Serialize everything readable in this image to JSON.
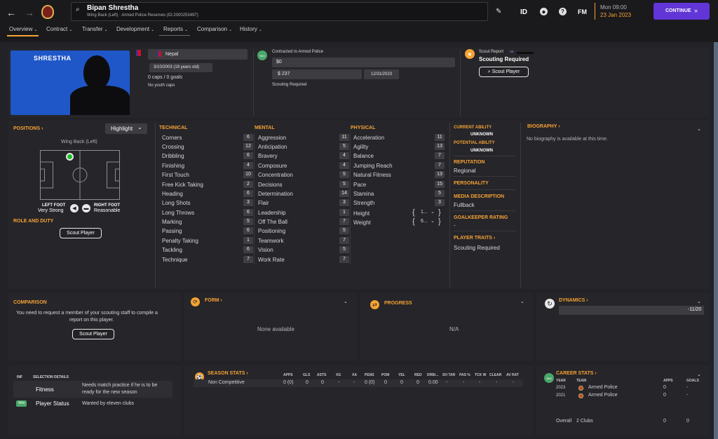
{
  "header": {
    "player_name": "Bipan Shrestha",
    "player_sub": "Wing Back (Left) · Armed Police Reserves (ID:2000253497)",
    "id_label": "ID",
    "fm_label": "FM",
    "time": "Mon 09:00",
    "date": "23 Jan 2023",
    "continue_label": "CONTINUE"
  },
  "nav": {
    "tabs": [
      "Overview",
      "Contract",
      "Transfer",
      "Development",
      "Reports",
      "Comparison",
      "History"
    ]
  },
  "profile": {
    "surname": "SHRESTHA",
    "nation": "Nepal",
    "dob": "3/10/2003 (19 years old)",
    "caps": "0 caps / 0 goals",
    "youth_caps": "No youth caps",
    "contract_title": "Contracted to Armed Police",
    "value": "$0",
    "wage": "$ 237",
    "contract_end": "12/31/2023",
    "contract_note": "Scouting Required",
    "scout_report_label": "Scout Report",
    "scouting_required": "Scouting Required",
    "scout_button": "Scout Player"
  },
  "positions": {
    "title": "POSITIONS",
    "highlight": "Highlight",
    "position": "Wing Back (Left)",
    "left_foot_label": "LEFT FOOT",
    "left_foot_value": "Very Strong",
    "right_foot_label": "RIGHT FOOT",
    "right_foot_value": "Reasonable",
    "role_title": "ROLE AND DUTY",
    "scout_button": "Scout Player"
  },
  "technical": {
    "title": "TECHNICAL",
    "rows": [
      {
        "name": "Corners",
        "value": "6"
      },
      {
        "name": "Crossing",
        "value": "12"
      },
      {
        "name": "Dribbling",
        "value": "6"
      },
      {
        "name": "Finishing",
        "value": "4"
      },
      {
        "name": "First Touch",
        "value": "10"
      },
      {
        "name": "Free Kick Taking",
        "value": "2"
      },
      {
        "name": "Heading",
        "value": "6"
      },
      {
        "name": "Long Shots",
        "value": "3"
      },
      {
        "name": "Long Throws",
        "value": "6"
      },
      {
        "name": "Marking",
        "value": "5"
      },
      {
        "name": "Passing",
        "value": "6"
      },
      {
        "name": "Penalty Taking",
        "value": "1"
      },
      {
        "name": "Tackling",
        "value": "6"
      },
      {
        "name": "Technique",
        "value": "7"
      }
    ]
  },
  "mental": {
    "title": "MENTAL",
    "rows": [
      {
        "name": "Aggression",
        "value": "11"
      },
      {
        "name": "Anticipation",
        "value": "5"
      },
      {
        "name": "Bravery",
        "value": "4"
      },
      {
        "name": "Composure",
        "value": "4"
      },
      {
        "name": "Concentration",
        "value": "5"
      },
      {
        "name": "Decisions",
        "value": "5"
      },
      {
        "name": "Determination",
        "value": "14"
      },
      {
        "name": "Flair",
        "value": "3"
      },
      {
        "name": "Leadership",
        "value": "1"
      },
      {
        "name": "Off The Ball",
        "value": "7"
      },
      {
        "name": "Positioning",
        "value": "5"
      },
      {
        "name": "Teamwork",
        "value": "7"
      },
      {
        "name": "Vision",
        "value": "5"
      },
      {
        "name": "Work Rate",
        "value": "7"
      }
    ]
  },
  "physical": {
    "title": "PHYSICAL",
    "rows": [
      {
        "name": "Acceleration",
        "value": "11"
      },
      {
        "name": "Agility",
        "value": "13"
      },
      {
        "name": "Balance",
        "value": "7"
      },
      {
        "name": "Jumping Reach",
        "value": "7"
      },
      {
        "name": "Natural Fitness",
        "value": "13"
      },
      {
        "name": "Pace",
        "value": "15"
      },
      {
        "name": "Stamina",
        "value": "5"
      },
      {
        "name": "Strength",
        "value": "3"
      }
    ],
    "height_label": "Height",
    "height_value": "1...",
    "weight_label": "Weight",
    "weight_value": "6..."
  },
  "ability": {
    "current_label": "CURRENT ABILITY",
    "current_value": "UNKNOWN",
    "potential_label": "POTENTIAL ABILITY",
    "potential_value": "UNKNOWN",
    "reputation_label": "REPUTATION",
    "reputation_value": "Regional",
    "personality_label": "PERSONALITY",
    "media_label": "MEDIA DESCRIPTION",
    "media_value": "Fullback",
    "gk_label": "GOALKEEPER RATING",
    "gk_value": "-",
    "traits_label": "PLAYER TRAITS",
    "traits_value": "Scouting Required"
  },
  "biography": {
    "title": "BIOGRAPHY",
    "text": "No biography is available at this time."
  },
  "comparison": {
    "title": "COMPARISON",
    "text1": "You need to request a member of your scouting staff to compile a",
    "text2": "report on this player.",
    "button": "Scout Player"
  },
  "form": {
    "title": "FORM",
    "text": "None available"
  },
  "progress": {
    "title": "PROGRESS",
    "text": "N/A"
  },
  "dynamics": {
    "title": "DYNAMICS",
    "value": "-11/20"
  },
  "info": {
    "inf_label": "INF",
    "selection_label": "SELECTION DETAILS",
    "fitness_label": "Fitness",
    "fitness_text1": "Needs match practice if he is to be",
    "fitness_text2": "ready for the new season",
    "status_label": "Player Status",
    "status_text": "Wanted by eleven clubs",
    "wnt": "Wnt"
  },
  "season_stats": {
    "title": "SEASON STATS",
    "columns": [
      "APPS",
      "GLS",
      "ASTS",
      "XG",
      "XA",
      "PENS",
      "POM",
      "YEL",
      "RED",
      "DRB/...",
      "SH TAR",
      "PAS %",
      "TCK W",
      "CLEAR",
      "AV RAT"
    ],
    "row_label": "Non Competitive",
    "row_values": [
      "0 (0)",
      "0",
      "0",
      "-",
      "-",
      "0 (0)",
      "0",
      "0",
      "0",
      "0.00",
      "-",
      "-",
      "-",
      "-",
      "-"
    ]
  },
  "career_stats": {
    "title": "CAREER STATS",
    "year_col": "YEAR",
    "team_col": "TEAM",
    "apps_col": "APPS",
    "goals_col": "GOALS",
    "rows": [
      {
        "year": "2023",
        "team": "Armed Police",
        "apps": "0",
        "goals": "-"
      },
      {
        "year": "2021",
        "team": "Armed Police",
        "apps": "0",
        "goals": "-"
      }
    ],
    "overall_label": "Overall",
    "overall_clubs": "2 Clubs",
    "overall_apps": "0",
    "overall_goals": "0",
    "wnt": "Wnt"
  }
}
